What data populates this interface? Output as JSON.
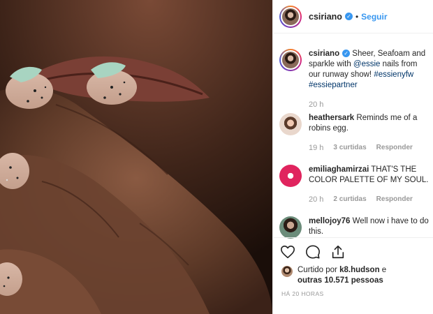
{
  "header": {
    "username": "csiriano",
    "separator": "•",
    "follow_label": "Seguir"
  },
  "caption": {
    "username": "csiriano",
    "text_before": " Sheer, Seafoam and sparkle with ",
    "mention": "@essie",
    "text_after": " nails from our runway show! ",
    "hashtag1": "#essienyfw",
    "hashtag2": "#essiepartner",
    "time": "20 h"
  },
  "comments": [
    {
      "username": "heathersark",
      "text": " Reminds me of a robins egg.",
      "time": "19 h",
      "likes": "3 curtidas",
      "reply": "Responder"
    },
    {
      "username": "emiliaghamirzai",
      "text": " THAT'S THE COLOR PALETTE OF MY SOUL.",
      "time": "20 h",
      "likes": "2 curtidas",
      "reply": "Responder"
    },
    {
      "username": "mellojoy76",
      "text": " Well now i have to do this."
    }
  ],
  "likes": {
    "prefix": "Curtido por ",
    "user": "k8.hudson",
    "middle": " e ",
    "others": "outras 10.571 pessoas"
  },
  "time_ago": "HÁ 20 HORAS",
  "icons": {
    "verified": "verified-badge-icon",
    "like": "heart-icon",
    "comment": "comment-bubble-icon",
    "share": "share-icon"
  },
  "colors": {
    "link": "#3897f0",
    "text": "#262626",
    "muted": "#999999",
    "nail": "#a8d4c1"
  }
}
